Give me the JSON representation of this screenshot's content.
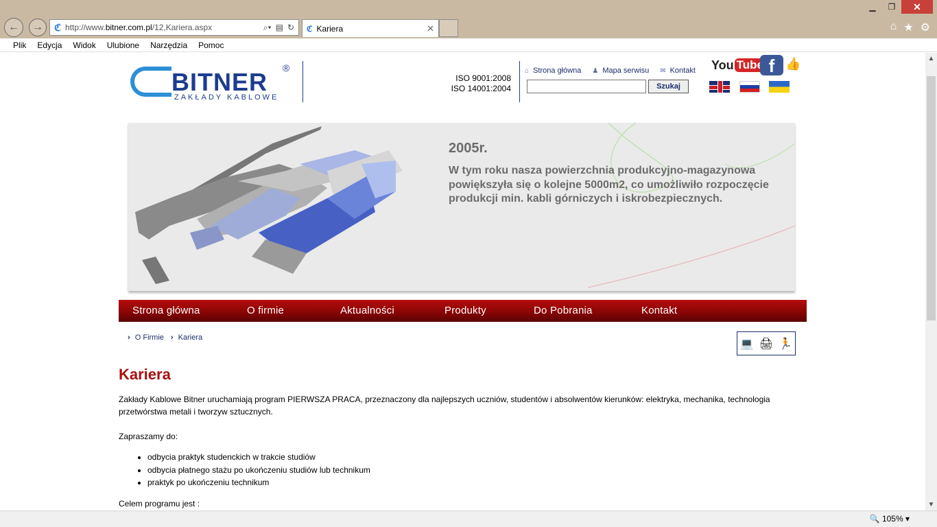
{
  "browser": {
    "url_prefix": "http://www.",
    "url_domain": "bitner.com.pl",
    "url_path": "/12,Kariera.aspx",
    "tab_title": "Kariera",
    "menu": [
      "Plik",
      "Edycja",
      "Widok",
      "Ulubione",
      "Narzędzia",
      "Pomoc"
    ],
    "zoom": "105%"
  },
  "header": {
    "brand": "BITNER",
    "brand_mark": "®",
    "brand_sub": "ZAKŁADY KABLOWE",
    "iso1": "ISO 9001:2008",
    "iso2": "ISO 14001:2004",
    "links": [
      "Strona główna",
      "Mapa serwisu",
      "Kontakt"
    ],
    "search_button": "Szukaj",
    "youtube_you": "You",
    "youtube_tube": "Tube",
    "facebook": "f"
  },
  "banner": {
    "year": "2005r.",
    "text": "W tym roku nasza powierzchnia produkcyjno-magazynowa powiększyła się o kolejne 5000m2, co umożliwiło rozpoczęcie produkcji min. kabli górniczych i iskrobezpiecznych."
  },
  "nav": [
    "Strona główna",
    "O firmie",
    "Aktualności",
    "Produkty",
    "Do Pobrania",
    "Kontakt"
  ],
  "breadcrumb": [
    "O Firmie",
    "Kariera"
  ],
  "content": {
    "title": "Kariera",
    "intro": "Zakłady Kablowe Bitner uruchamiają  program PIERWSZA PRACA, przeznaczony dla najlepszych uczniów, studentów i absolwentów kierunków: elektryka, mechanika, technologia przetwórstwa metali i tworzyw sztucznych.",
    "invite": "Zapraszamy do:",
    "list": [
      "odbycia praktyk studenckich w trakcie studiów",
      "odbycia płatnego stażu po ukończeniu studiów lub technikum",
      "praktyk po ukończeniu technikum"
    ],
    "goal": "Celem programu jest :"
  }
}
